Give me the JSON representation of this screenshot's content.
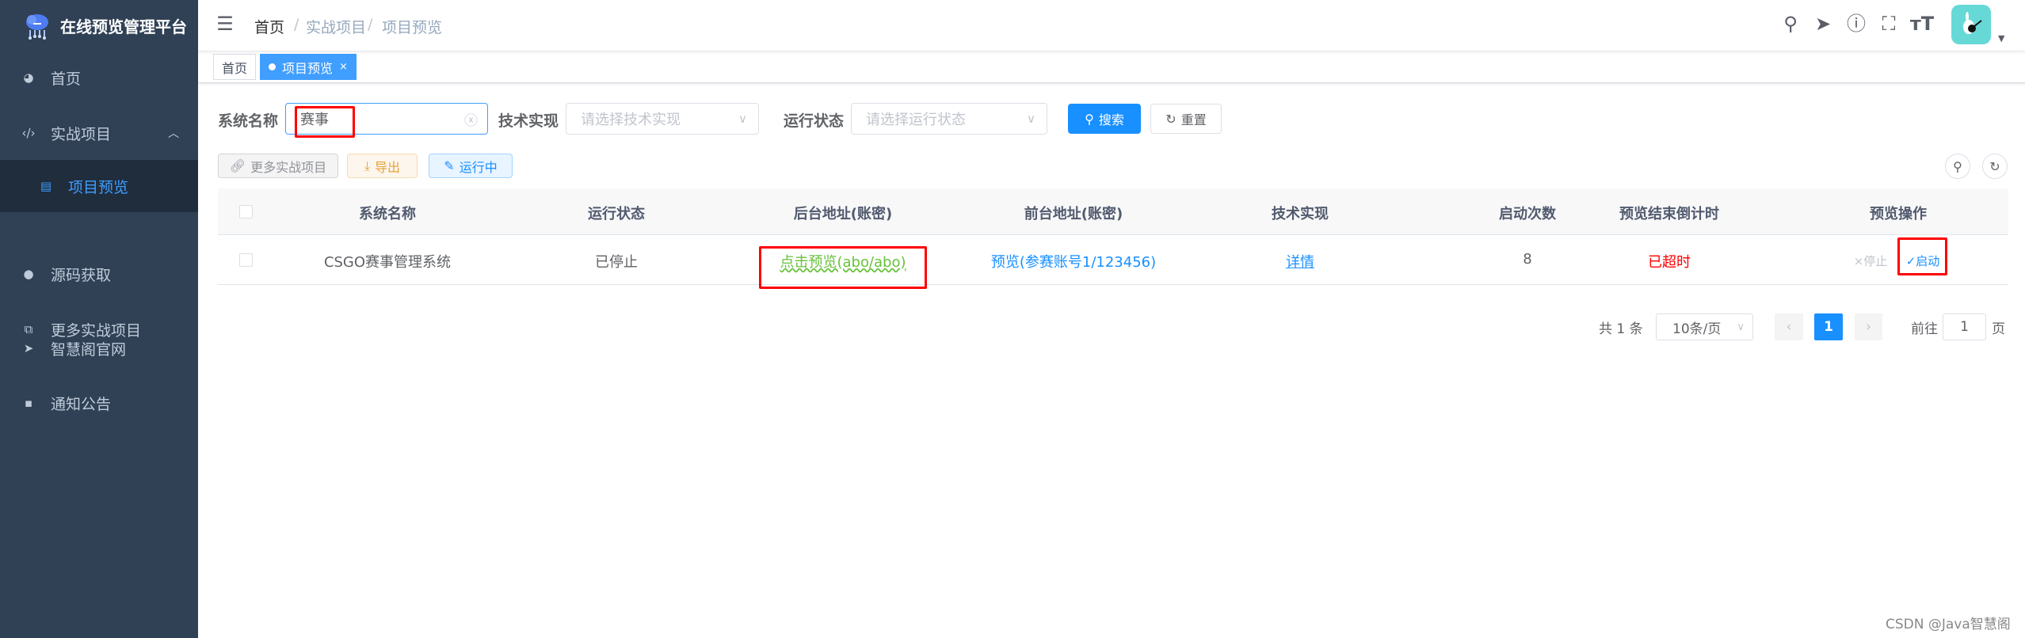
{
  "app": {
    "title": "在线预览管理平台"
  },
  "sidebar": {
    "items": [
      {
        "label": "首页",
        "icon": "dashboard-icon"
      },
      {
        "label": "实战项目",
        "icon": "code-icon",
        "expanded": true
      },
      {
        "label": "项目预览",
        "icon": "document-icon",
        "active": true
      },
      {
        "label": "源码获取",
        "icon": "wechat-icon"
      },
      {
        "label": "更多实战项目",
        "icon": "external-link-icon"
      },
      {
        "label": "智慧阁官网",
        "icon": "send-icon"
      },
      {
        "label": "通知公告",
        "icon": "message-icon"
      }
    ]
  },
  "header": {
    "breadcrumb": [
      "首页",
      "实战项目",
      "项目预览"
    ],
    "separator": "/",
    "icons": [
      "search-icon",
      "send-icon",
      "question-icon",
      "fullscreen-icon",
      "font-size-icon"
    ]
  },
  "tags": [
    {
      "label": "首页"
    },
    {
      "label": "项目预览",
      "active": true,
      "close": "×"
    }
  ],
  "search": {
    "name_label": "系统名称",
    "name_value": "赛事",
    "tech_label": "技术实现",
    "tech_placeholder": "请选择技术实现",
    "status_label": "运行状态",
    "status_placeholder": "请选择运行状态",
    "search_button": "搜索",
    "reset_button": "重置"
  },
  "toolbar": {
    "more_button": "更多实战项目",
    "export_button": "导出",
    "running_button": "运行中"
  },
  "table": {
    "columns": [
      "系统名称",
      "运行状态",
      "后台地址(账密)",
      "前台地址(账密)",
      "技术实现",
      "启动次数",
      "预览结束倒计时",
      "预览操作"
    ],
    "rows": [
      {
        "name": "CSGO赛事管理系统",
        "status": "已停止",
        "backend": "点击预览(abo/abo)",
        "frontend": "预览(参赛账号1/123456)",
        "tech": "详情",
        "count": "8",
        "countdown": "已超时",
        "stop": "×停止",
        "start": "✓启动"
      }
    ]
  },
  "pagination": {
    "total": "共 1 条",
    "page_size": "10条/页",
    "current": "1",
    "goto_label": "前往",
    "goto_value": "1",
    "page_suffix": "页"
  },
  "watermark": "CSDN @Java智慧阁",
  "colors": {
    "sidebar": "#304156",
    "primary": "#409eff",
    "danger": "#ff0000",
    "success": "#67c23a",
    "avatar": "#66d9d6"
  }
}
